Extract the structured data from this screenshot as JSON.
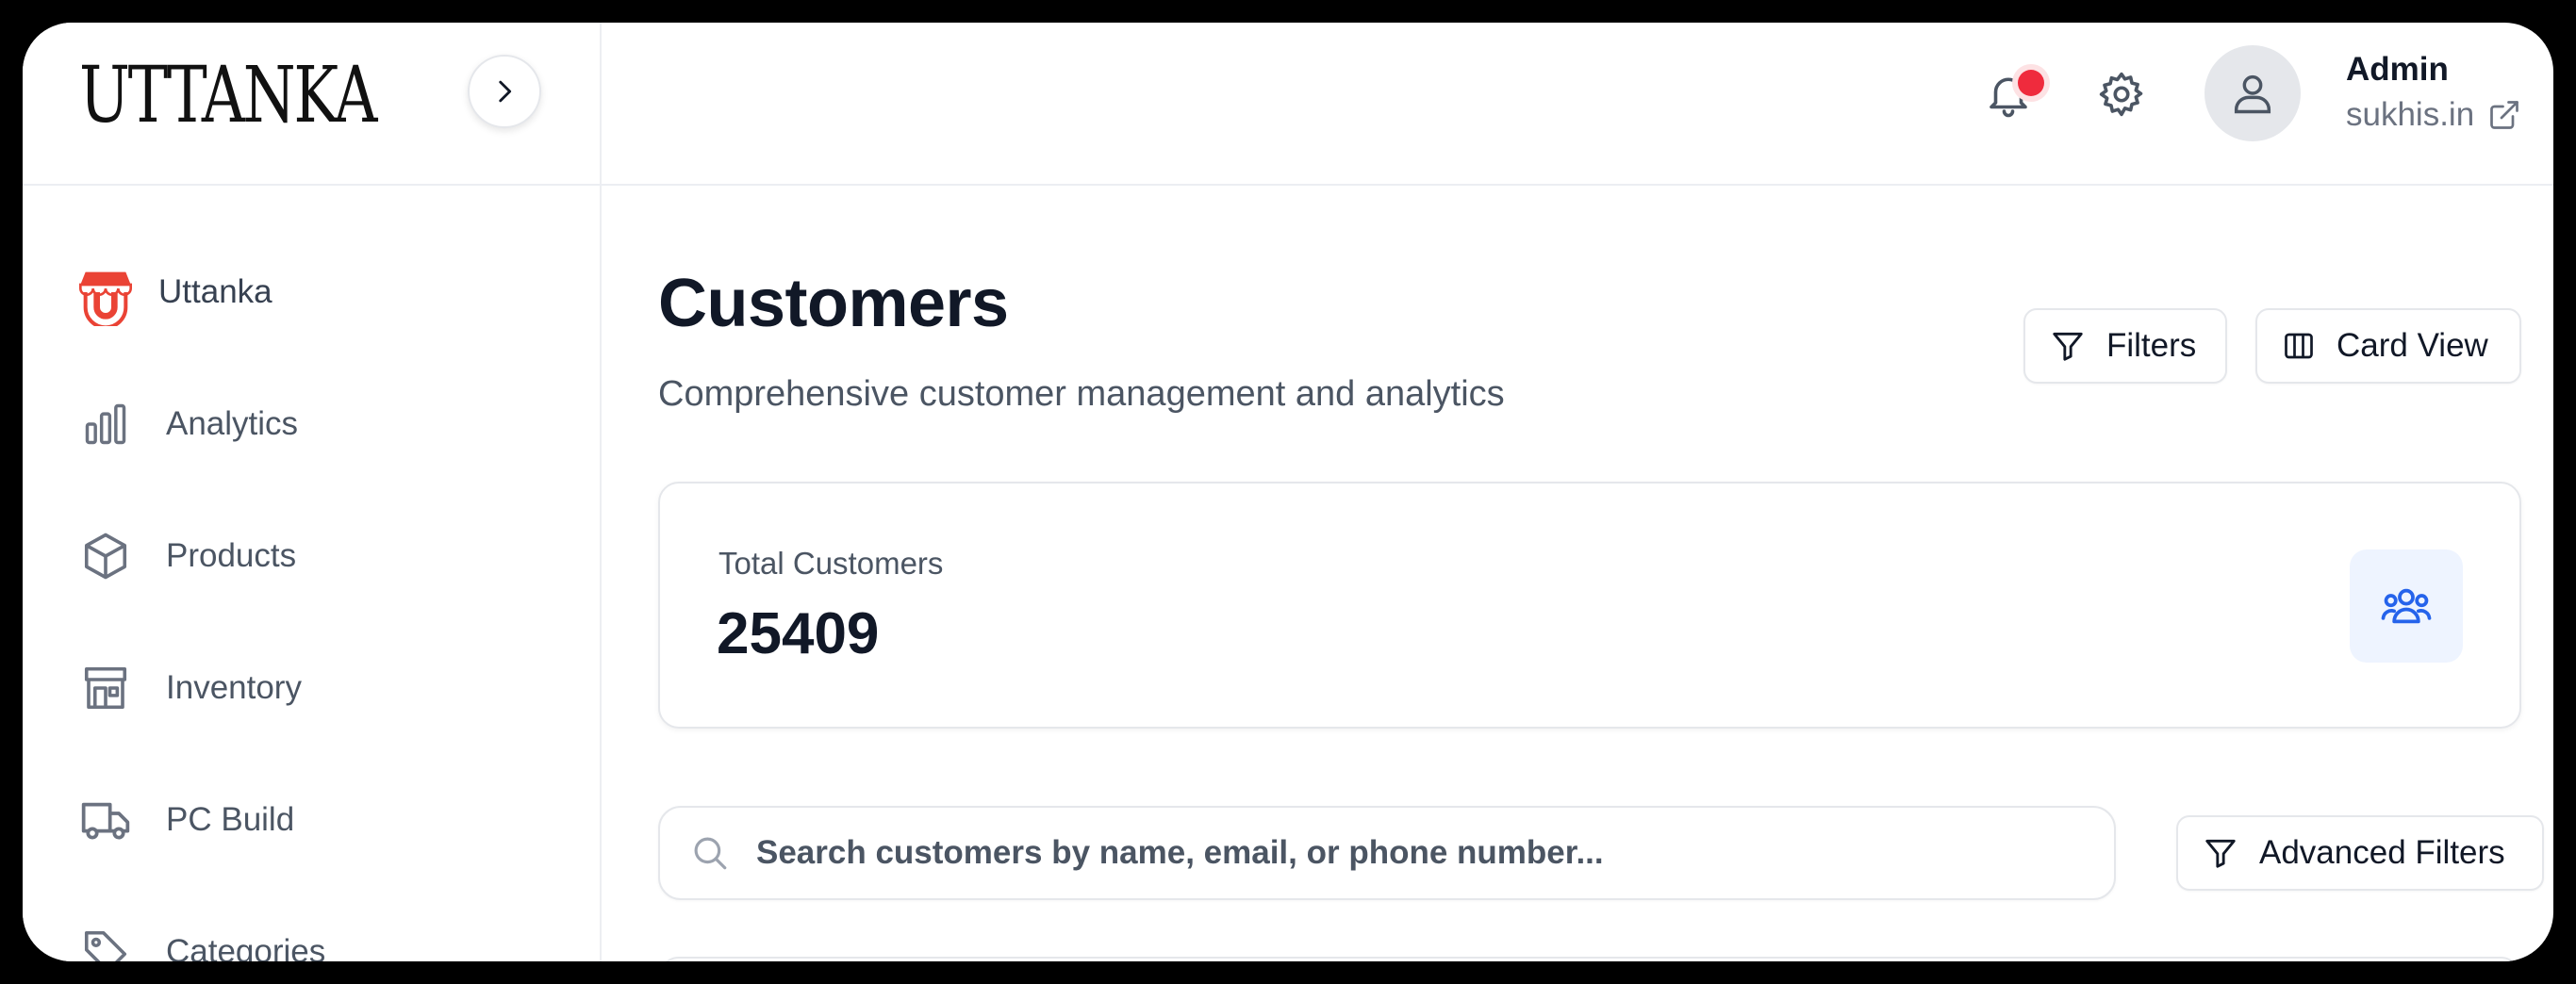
{
  "brand": {
    "logo_text": "UTTANKA"
  },
  "sidebar": {
    "items": [
      {
        "label": "Uttanka",
        "icon": "store-icon"
      },
      {
        "label": "Analytics",
        "icon": "bar-chart-icon"
      },
      {
        "label": "Products",
        "icon": "box-icon"
      },
      {
        "label": "Inventory",
        "icon": "warehouse-icon"
      },
      {
        "label": "PC Build",
        "icon": "truck-icon"
      },
      {
        "label": "Categories",
        "icon": "tag-icon"
      }
    ]
  },
  "header": {
    "user_name": "Admin",
    "user_site": "sukhis.in",
    "notification_badge_color": "#ef2b3d"
  },
  "page": {
    "title": "Customers",
    "subtitle": "Comprehensive customer management and analytics",
    "filters_label": "Filters",
    "card_view_label": "Card View"
  },
  "stats": {
    "total_label": "Total Customers",
    "total_value": "25409",
    "icon_color": "#2563eb"
  },
  "search": {
    "placeholder": "Search customers by name, email, or phone number...",
    "value": "",
    "advanced_filters_label": "Advanced Filters"
  },
  "colors": {
    "accent": "#2563eb",
    "brand_red": "#ea4335"
  }
}
